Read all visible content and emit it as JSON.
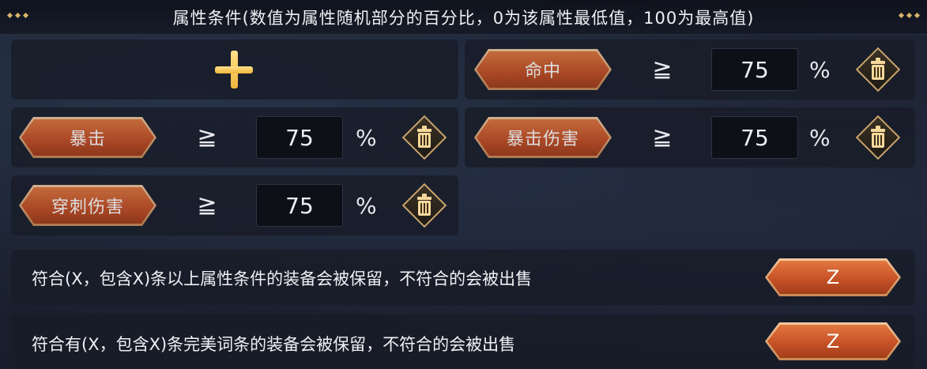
{
  "header": {
    "title": "属性条件(数值为属性随机部分的百分比，0为该属性最低值，100为最高值)"
  },
  "conditions": [
    {
      "attribute": "命中",
      "operator": "≧",
      "value": "75",
      "unit": "%"
    },
    {
      "attribute": "暴击",
      "operator": "≧",
      "value": "75",
      "unit": "%"
    },
    {
      "attribute": "暴击伤害",
      "operator": "≧",
      "value": "75",
      "unit": "%"
    },
    {
      "attribute": "穿刺伤害",
      "operator": "≧",
      "value": "75",
      "unit": "%"
    }
  ],
  "rules": [
    {
      "text": "符合(X，包含X)条以上属性条件的装备会被保留，不符合的会被出售",
      "button": "Z"
    },
    {
      "text": "符合有(X，包含X)条完美词条的装备会被保留，不符合的会被出售",
      "button": "Z"
    }
  ],
  "icons": {
    "add": "plus-icon",
    "delete": "trash-icon"
  },
  "colors": {
    "accent": "#c75227",
    "gold": "#f0b63a",
    "frame": "#c9a46a"
  }
}
